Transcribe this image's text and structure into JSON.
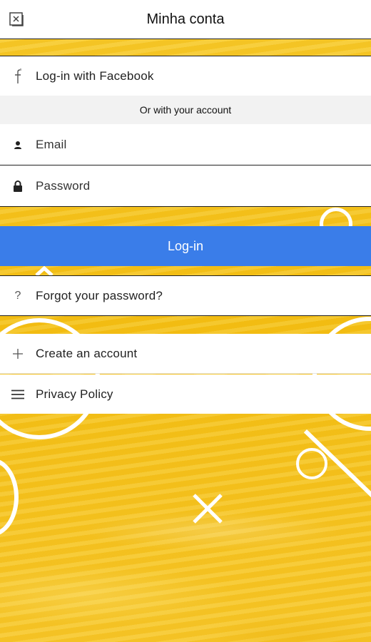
{
  "header": {
    "title": "Minha conta",
    "close_icon": "close-icon"
  },
  "facebook": {
    "label": "Log-in with Facebook",
    "icon": "facebook-icon"
  },
  "divider": {
    "label": "Or with your account"
  },
  "form": {
    "email_placeholder": "Email",
    "password_placeholder": "Password",
    "login_label": "Log-in"
  },
  "links": {
    "forgot": "Forgot your password?",
    "forgot_icon_glyph": "?",
    "create": "Create an account",
    "privacy": "Privacy Policy"
  },
  "colors": {
    "accent": "#3a7de9",
    "background": "#f3c21e"
  }
}
